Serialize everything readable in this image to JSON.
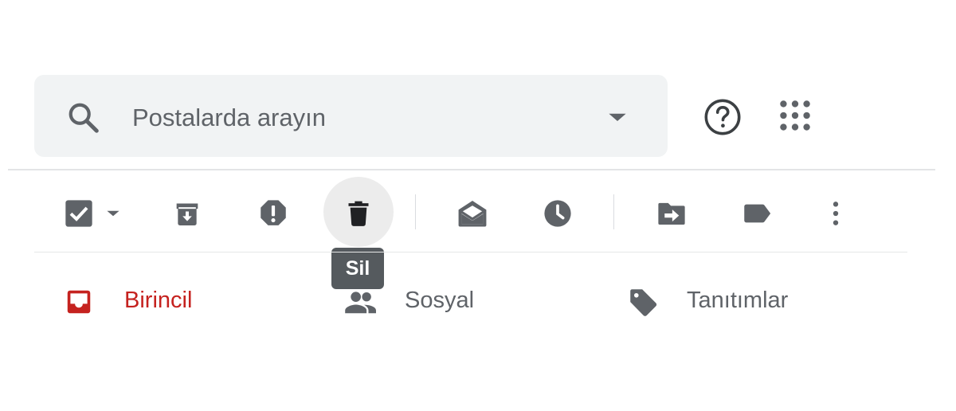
{
  "search": {
    "placeholder": "Postalarda arayın",
    "icon": "search-icon",
    "options_icon": "arrow-drop-down-icon"
  },
  "header": {
    "help_icon": "help-circle-icon",
    "apps_icon": "apps-grid-icon"
  },
  "toolbar": {
    "buttons": [
      {
        "icon": "select-all-checkbox-icon"
      },
      {
        "icon": "select-dropdown-icon"
      },
      {
        "icon": "archive-icon"
      },
      {
        "icon": "report-spam-icon"
      },
      {
        "icon": "delete-icon",
        "hovered": true
      },
      {
        "icon": "mark-as-read-icon"
      },
      {
        "icon": "snooze-clock-icon"
      },
      {
        "icon": "move-to-icon"
      },
      {
        "icon": "label-icon"
      },
      {
        "icon": "more-vert-icon"
      }
    ],
    "tooltip": "Sil"
  },
  "tabs": [
    {
      "label": "Birincil",
      "icon": "inbox-icon",
      "active": true,
      "color": "#c5221f"
    },
    {
      "label": "Sosyal",
      "icon": "people-icon",
      "active": false,
      "color": "#5f6368"
    },
    {
      "label": "Tanıtımlar",
      "icon": "tag-icon",
      "active": false,
      "color": "#5f6368"
    }
  ],
  "colors": {
    "search_bg": "#f1f3f4",
    "icon_gray": "#5f6368",
    "active_red": "#c5221f",
    "tooltip_bg": "#555a5e"
  }
}
